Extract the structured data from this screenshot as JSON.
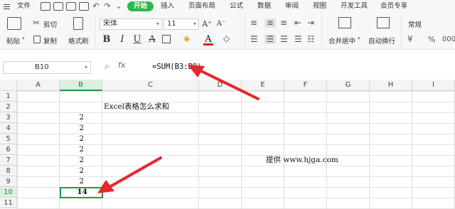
{
  "menu": {
    "file": "文件",
    "start": "开始",
    "tabs": [
      "插入",
      "页面布局",
      "公式",
      "数据",
      "审阅",
      "视图",
      "开发工具",
      "会员专享"
    ]
  },
  "ribbon": {
    "paste": "粘贴",
    "cut": "剪切",
    "copy": "复制",
    "format_painter": "格式刷",
    "font_name": "宋体",
    "font_size": "11",
    "merge_center": "合并居中",
    "wrap_text": "自动换行",
    "number_format": "常规"
  },
  "formula_bar": {
    "name_box": "B10",
    "fx": "fx",
    "formula": "=SUM(B3:B9)"
  },
  "sheet": {
    "columns": [
      "A",
      "B",
      "C",
      "D",
      "E",
      "F",
      "G",
      "H",
      "I"
    ],
    "rows": [
      "1",
      "2",
      "3",
      "4",
      "5",
      "6",
      "7",
      "8",
      "9",
      "10",
      "11"
    ],
    "selected_column": "B",
    "selected_row": "10",
    "title_cell": "Excel表格怎么求和",
    "b_values": [
      "2",
      "2",
      "2",
      "2",
      "2",
      "2",
      "2"
    ],
    "total": "14",
    "watermark": "提供 www.hjga.com"
  },
  "colors": {
    "accent": "#2db84a",
    "selection": "#1f9a46",
    "arrow": "#e8262c"
  }
}
